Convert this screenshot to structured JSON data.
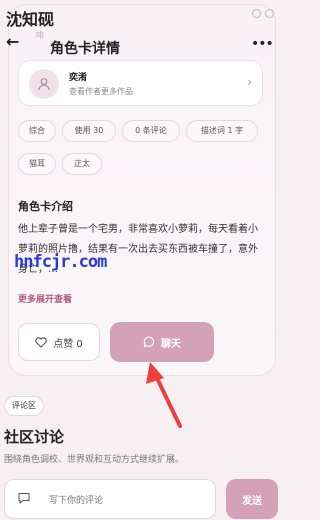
{
  "status_bar": {
    "title": "沈知砚"
  },
  "bg_text": "啡",
  "nav": {
    "title": "角色卡详情",
    "more_glyph": "•••"
  },
  "author": {
    "name": "奕淆",
    "subtitle": "查看作者更多作品"
  },
  "tags": [
    {
      "label": "综合"
    },
    {
      "label": "使用 30"
    },
    {
      "label": "0 条评论"
    },
    {
      "label": "描述词 1 字"
    },
    {
      "label": "猫耳"
    },
    {
      "label": "正太"
    }
  ],
  "intro": {
    "title": "角色卡介绍",
    "body": "他上辈子曾是一个宅男，非常喜欢小萝莉，每天看着小萝莉的照片撸，结果有一次出去买东西被车撞了，意外身亡，…",
    "expand_label": "更多展开查看"
  },
  "watermark": "hnfcjr.com",
  "actions": {
    "like_label": "点赞 0",
    "chat_label": "聊天"
  },
  "comments": {
    "badge": "评论区",
    "title": "社区讨论",
    "subtitle": "围绕角色调校、世界观和互动方式继续扩展。",
    "input_placeholder": "写下你的评论",
    "send_label": "发送"
  },
  "colors": {
    "accent": "#d3a2b7",
    "accent_text": "#b25d7f",
    "annotation_arrow": "#ee3e3e"
  }
}
